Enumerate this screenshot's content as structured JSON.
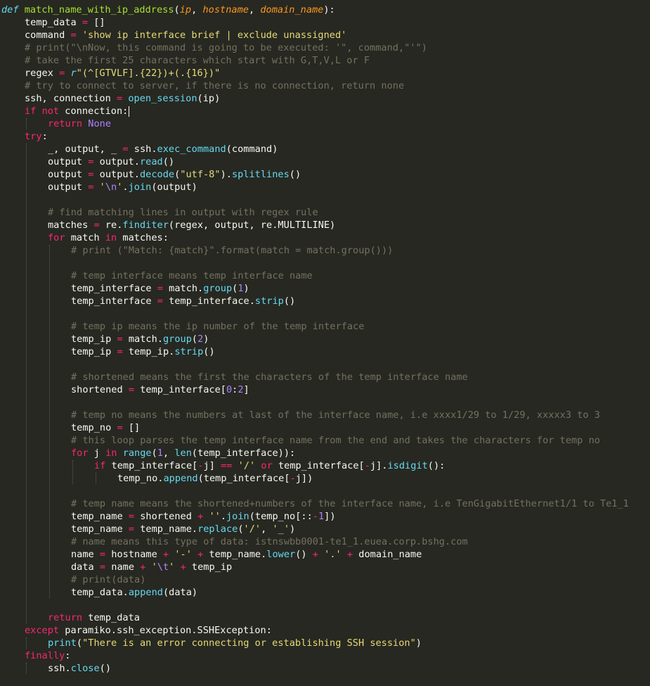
{
  "editor": {
    "theme": {
      "background": "#272822",
      "foreground": "#f8f8f2",
      "keyword": "#f92672",
      "storage": "#66d9ef",
      "function_name": "#a6e22e",
      "parameter": "#fd971f",
      "string": "#e6db74",
      "comment": "#75715e",
      "builtin": "#66d9ef",
      "constant": "#ae81ff"
    },
    "lines": [
      {
        "indent": 0,
        "tokens": [
          [
            "kwi",
            "def"
          ],
          [
            "plain",
            " "
          ],
          [
            "fn",
            "match_name_with_ip_address"
          ],
          [
            "plain",
            "("
          ],
          [
            "param",
            "ip"
          ],
          [
            "plain",
            ", "
          ],
          [
            "param",
            "hostname"
          ],
          [
            "plain",
            ", "
          ],
          [
            "param",
            "domain_name"
          ],
          [
            "plain",
            "):"
          ]
        ]
      },
      {
        "indent": 1,
        "tokens": [
          [
            "plain",
            "temp_data "
          ],
          [
            "op",
            "="
          ],
          [
            "plain",
            " []"
          ]
        ]
      },
      {
        "indent": 1,
        "tokens": [
          [
            "plain",
            "command "
          ],
          [
            "op",
            "="
          ],
          [
            "plain",
            " "
          ],
          [
            "str",
            "'show ip interface brief | exclude unassigned'"
          ]
        ]
      },
      {
        "indent": 1,
        "tokens": [
          [
            "cmt",
            "# print(\"\\nNow, this command is going to be executed: '\", command,\"'\")"
          ]
        ]
      },
      {
        "indent": 1,
        "tokens": [
          [
            "cmt",
            "# take the first 25 characters which start with G,T,V,L or F"
          ]
        ]
      },
      {
        "indent": 1,
        "tokens": [
          [
            "plain",
            "regex "
          ],
          [
            "op",
            "="
          ],
          [
            "plain",
            " "
          ],
          [
            "kwi",
            "r"
          ],
          [
            "str",
            "\"(^[GTVLF].{22})+(.{16})\""
          ]
        ]
      },
      {
        "indent": 1,
        "tokens": [
          [
            "cmt",
            "# try to connect to server, if there is no connection, return none"
          ]
        ]
      },
      {
        "indent": 1,
        "tokens": [
          [
            "plain",
            "ssh, connection "
          ],
          [
            "op",
            "="
          ],
          [
            "plain",
            " "
          ],
          [
            "call",
            "open_session"
          ],
          [
            "plain",
            "(ip)"
          ]
        ]
      },
      {
        "indent": 1,
        "cursor": true,
        "tokens": [
          [
            "kw",
            "if"
          ],
          [
            "plain",
            " "
          ],
          [
            "kw",
            "not"
          ],
          [
            "plain",
            " connection:"
          ]
        ]
      },
      {
        "indent": 2,
        "tokens": [
          [
            "kw",
            "return"
          ],
          [
            "plain",
            " "
          ],
          [
            "const",
            "None"
          ]
        ]
      },
      {
        "indent": 1,
        "tokens": [
          [
            "kw",
            "try"
          ],
          [
            "plain",
            ":"
          ]
        ]
      },
      {
        "indent": 2,
        "tokens": [
          [
            "plain",
            "_, output, _ "
          ],
          [
            "op",
            "="
          ],
          [
            "plain",
            " ssh."
          ],
          [
            "call",
            "exec_command"
          ],
          [
            "plain",
            "(command)"
          ]
        ]
      },
      {
        "indent": 2,
        "tokens": [
          [
            "plain",
            "output "
          ],
          [
            "op",
            "="
          ],
          [
            "plain",
            " output."
          ],
          [
            "call",
            "read"
          ],
          [
            "plain",
            "()"
          ]
        ]
      },
      {
        "indent": 2,
        "tokens": [
          [
            "plain",
            "output "
          ],
          [
            "op",
            "="
          ],
          [
            "plain",
            " output."
          ],
          [
            "call",
            "decode"
          ],
          [
            "plain",
            "("
          ],
          [
            "str",
            "\"utf-8\""
          ],
          [
            "plain",
            ")."
          ],
          [
            "call",
            "splitlines"
          ],
          [
            "plain",
            "()"
          ]
        ]
      },
      {
        "indent": 2,
        "tokens": [
          [
            "plain",
            "output "
          ],
          [
            "op",
            "="
          ],
          [
            "plain",
            " "
          ],
          [
            "str",
            "'"
          ],
          [
            "const",
            "\\n"
          ],
          [
            "str",
            "'"
          ],
          [
            "plain",
            "."
          ],
          [
            "call",
            "join"
          ],
          [
            "plain",
            "(output)"
          ]
        ]
      },
      {
        "indent": 2,
        "tokens": []
      },
      {
        "indent": 2,
        "tokens": [
          [
            "cmt",
            "# find matching lines in output with regex rule"
          ]
        ]
      },
      {
        "indent": 2,
        "tokens": [
          [
            "plain",
            "matches "
          ],
          [
            "op",
            "="
          ],
          [
            "plain",
            " re."
          ],
          [
            "call",
            "finditer"
          ],
          [
            "plain",
            "(regex, output, re.MULTILINE)"
          ]
        ]
      },
      {
        "indent": 2,
        "tokens": [
          [
            "kw",
            "for"
          ],
          [
            "plain",
            " match "
          ],
          [
            "kw",
            "in"
          ],
          [
            "plain",
            " matches:"
          ]
        ]
      },
      {
        "indent": 3,
        "tokens": [
          [
            "cmt",
            "# print (\"Match: {match}\".format(match = match.group()))"
          ]
        ]
      },
      {
        "indent": 3,
        "tokens": []
      },
      {
        "indent": 3,
        "tokens": [
          [
            "cmt",
            "# temp interface means temp interface name"
          ]
        ]
      },
      {
        "indent": 3,
        "tokens": [
          [
            "plain",
            "temp_interface "
          ],
          [
            "op",
            "="
          ],
          [
            "plain",
            " match."
          ],
          [
            "call",
            "group"
          ],
          [
            "plain",
            "("
          ],
          [
            "const",
            "1"
          ],
          [
            "plain",
            ")"
          ]
        ]
      },
      {
        "indent": 3,
        "tokens": [
          [
            "plain",
            "temp_interface "
          ],
          [
            "op",
            "="
          ],
          [
            "plain",
            " temp_interface."
          ],
          [
            "call",
            "strip"
          ],
          [
            "plain",
            "()"
          ]
        ]
      },
      {
        "indent": 3,
        "tokens": []
      },
      {
        "indent": 3,
        "tokens": [
          [
            "cmt",
            "# temp ip means the ip number of the temp interface"
          ]
        ]
      },
      {
        "indent": 3,
        "tokens": [
          [
            "plain",
            "temp_ip "
          ],
          [
            "op",
            "="
          ],
          [
            "plain",
            " match."
          ],
          [
            "call",
            "group"
          ],
          [
            "plain",
            "("
          ],
          [
            "const",
            "2"
          ],
          [
            "plain",
            ")"
          ]
        ]
      },
      {
        "indent": 3,
        "tokens": [
          [
            "plain",
            "temp_ip "
          ],
          [
            "op",
            "="
          ],
          [
            "plain",
            " temp_ip."
          ],
          [
            "call",
            "strip"
          ],
          [
            "plain",
            "()"
          ]
        ]
      },
      {
        "indent": 3,
        "tokens": []
      },
      {
        "indent": 3,
        "tokens": [
          [
            "cmt",
            "# shortened means the first the characters of the temp interface name"
          ]
        ]
      },
      {
        "indent": 3,
        "tokens": [
          [
            "plain",
            "shortened "
          ],
          [
            "op",
            "="
          ],
          [
            "plain",
            " temp_interface["
          ],
          [
            "const",
            "0"
          ],
          [
            "plain",
            ":"
          ],
          [
            "const",
            "2"
          ],
          [
            "plain",
            "]"
          ]
        ]
      },
      {
        "indent": 3,
        "tokens": []
      },
      {
        "indent": 3,
        "tokens": [
          [
            "cmt",
            "# temp no means the numbers at last of the interface name, i.e xxxx1/29 to 1/29, xxxxx3 to 3"
          ]
        ]
      },
      {
        "indent": 3,
        "tokens": [
          [
            "plain",
            "temp_no "
          ],
          [
            "op",
            "="
          ],
          [
            "plain",
            " []"
          ]
        ]
      },
      {
        "indent": 3,
        "tokens": [
          [
            "cmt",
            "# this loop parses the temp interface name from the end and takes the characters for temp no"
          ]
        ]
      },
      {
        "indent": 3,
        "tokens": [
          [
            "kw",
            "for"
          ],
          [
            "plain",
            " j "
          ],
          [
            "kw",
            "in"
          ],
          [
            "plain",
            " "
          ],
          [
            "call",
            "range"
          ],
          [
            "plain",
            "("
          ],
          [
            "const",
            "1"
          ],
          [
            "plain",
            ", "
          ],
          [
            "call",
            "len"
          ],
          [
            "plain",
            "(temp_interface)):"
          ]
        ]
      },
      {
        "indent": 4,
        "tokens": [
          [
            "kw",
            "if"
          ],
          [
            "plain",
            " temp_interface["
          ],
          [
            "op",
            "-"
          ],
          [
            "plain",
            "j] "
          ],
          [
            "op",
            "=="
          ],
          [
            "plain",
            " "
          ],
          [
            "str",
            "'/'"
          ],
          [
            "plain",
            " "
          ],
          [
            "kw",
            "or"
          ],
          [
            "plain",
            " temp_interface["
          ],
          [
            "op",
            "-"
          ],
          [
            "plain",
            "j]."
          ],
          [
            "call",
            "isdigit"
          ],
          [
            "plain",
            "():"
          ]
        ]
      },
      {
        "indent": 5,
        "tokens": [
          [
            "plain",
            "temp_no."
          ],
          [
            "call",
            "append"
          ],
          [
            "plain",
            "(temp_interface["
          ],
          [
            "op",
            "-"
          ],
          [
            "plain",
            "j])"
          ]
        ]
      },
      {
        "indent": 3,
        "tokens": []
      },
      {
        "indent": 3,
        "tokens": [
          [
            "cmt",
            "# temp name means the shortened+numbers of the interface name, i.e TenGigabitEthernet1/1 to Te1_1"
          ]
        ]
      },
      {
        "indent": 3,
        "tokens": [
          [
            "plain",
            "temp_name "
          ],
          [
            "op",
            "="
          ],
          [
            "plain",
            " shortened "
          ],
          [
            "op",
            "+"
          ],
          [
            "plain",
            " "
          ],
          [
            "str",
            "''"
          ],
          [
            "plain",
            "."
          ],
          [
            "call",
            "join"
          ],
          [
            "plain",
            "(temp_no[::"
          ],
          [
            "op",
            "-"
          ],
          [
            "const",
            "1"
          ],
          [
            "plain",
            "])"
          ]
        ]
      },
      {
        "indent": 3,
        "tokens": [
          [
            "plain",
            "temp_name "
          ],
          [
            "op",
            "="
          ],
          [
            "plain",
            " temp_name."
          ],
          [
            "call",
            "replace"
          ],
          [
            "plain",
            "("
          ],
          [
            "str",
            "'/'"
          ],
          [
            "plain",
            ", "
          ],
          [
            "str",
            "'_'"
          ],
          [
            "plain",
            ")"
          ]
        ]
      },
      {
        "indent": 3,
        "tokens": [
          [
            "cmt",
            "# name means this type of data: istnswbb0001-te1_1.euea.corp.bshg.com"
          ]
        ]
      },
      {
        "indent": 3,
        "tokens": [
          [
            "plain",
            "name "
          ],
          [
            "op",
            "="
          ],
          [
            "plain",
            " hostname "
          ],
          [
            "op",
            "+"
          ],
          [
            "plain",
            " "
          ],
          [
            "str",
            "'-'"
          ],
          [
            "plain",
            " "
          ],
          [
            "op",
            "+"
          ],
          [
            "plain",
            " temp_name."
          ],
          [
            "call",
            "lower"
          ],
          [
            "plain",
            "() "
          ],
          [
            "op",
            "+"
          ],
          [
            "plain",
            " "
          ],
          [
            "str",
            "'.'"
          ],
          [
            "plain",
            " "
          ],
          [
            "op",
            "+"
          ],
          [
            "plain",
            " domain_name"
          ]
        ]
      },
      {
        "indent": 3,
        "tokens": [
          [
            "plain",
            "data "
          ],
          [
            "op",
            "="
          ],
          [
            "plain",
            " name "
          ],
          [
            "op",
            "+"
          ],
          [
            "plain",
            " "
          ],
          [
            "str",
            "'"
          ],
          [
            "const",
            "\\t"
          ],
          [
            "str",
            "'"
          ],
          [
            "plain",
            " "
          ],
          [
            "op",
            "+"
          ],
          [
            "plain",
            " temp_ip"
          ]
        ]
      },
      {
        "indent": 3,
        "tokens": [
          [
            "cmt",
            "# print(data)"
          ]
        ]
      },
      {
        "indent": 3,
        "tokens": [
          [
            "plain",
            "temp_data."
          ],
          [
            "call",
            "append"
          ],
          [
            "plain",
            "(data)"
          ]
        ]
      },
      {
        "indent": 2,
        "tokens": []
      },
      {
        "indent": 2,
        "tokens": [
          [
            "kw",
            "return"
          ],
          [
            "plain",
            " temp_data"
          ]
        ]
      },
      {
        "indent": 1,
        "tokens": [
          [
            "kw",
            "except"
          ],
          [
            "plain",
            " paramiko.ssh_exception.SSHException:"
          ]
        ]
      },
      {
        "indent": 2,
        "tokens": [
          [
            "call",
            "print"
          ],
          [
            "plain",
            "("
          ],
          [
            "str",
            "\"There is an error connecting or establishing SSH session\""
          ],
          [
            "plain",
            ")"
          ]
        ]
      },
      {
        "indent": 1,
        "tokens": [
          [
            "kw",
            "finally"
          ],
          [
            "plain",
            ":"
          ]
        ]
      },
      {
        "indent": 2,
        "tokens": [
          [
            "plain",
            "ssh."
          ],
          [
            "call",
            "close"
          ],
          [
            "plain",
            "()"
          ]
        ]
      }
    ]
  }
}
